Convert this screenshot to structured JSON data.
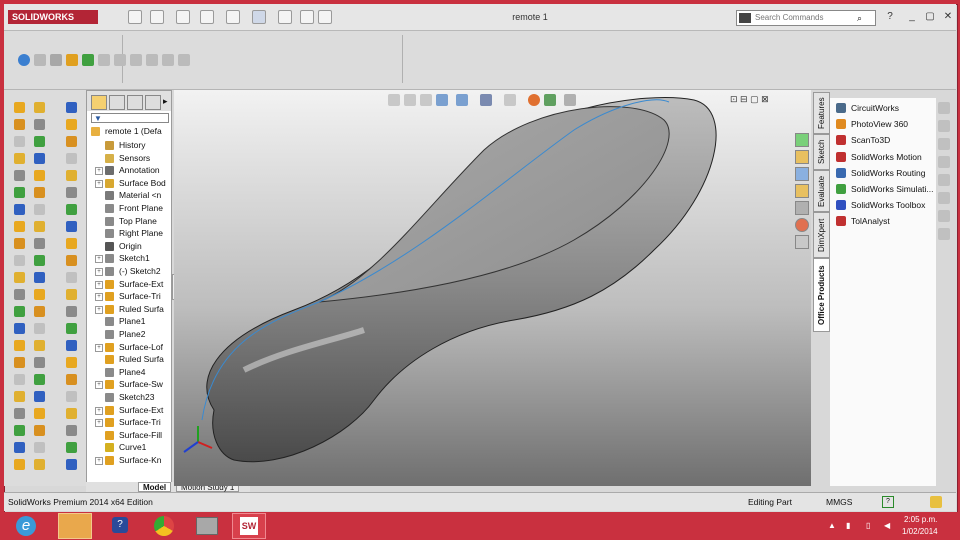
{
  "app": {
    "logo_text": "SOLIDWORKS",
    "doc_title": "remote 1"
  },
  "search": {
    "placeholder": "Search Commands"
  },
  "window_controls": {
    "help": "?",
    "minimize": "_",
    "restore": "▢",
    "close": "✕"
  },
  "feature_tree": {
    "root": "remote 1  (Defa",
    "items": [
      {
        "label": "History",
        "icon": "history-icon",
        "color": "#c89a3a",
        "expandable": false
      },
      {
        "label": "Sensors",
        "icon": "sensors-icon",
        "color": "#d6b048",
        "expandable": false
      },
      {
        "label": "Annotation",
        "icon": "annotations-icon",
        "color": "#6d6d6d",
        "expandable": true
      },
      {
        "label": "Surface Bod",
        "icon": "surface-bodies-icon",
        "color": "#d8a830",
        "expandable": true
      },
      {
        "label": "Material <n",
        "icon": "material-icon",
        "color": "#7a7a7a",
        "expandable": false
      },
      {
        "label": "Front Plane",
        "icon": "plane-icon",
        "color": "#8a8a8a",
        "expandable": false
      },
      {
        "label": "Top Plane",
        "icon": "plane-icon",
        "color": "#8a8a8a",
        "expandable": false
      },
      {
        "label": "Right Plane",
        "icon": "plane-icon",
        "color": "#8a8a8a",
        "expandable": false
      },
      {
        "label": "Origin",
        "icon": "origin-icon",
        "color": "#555555",
        "expandable": false
      },
      {
        "label": "Sketch1",
        "icon": "sketch-icon",
        "color": "#8a8a8a",
        "expandable": true
      },
      {
        "label": "(-) Sketch2",
        "icon": "sketch-icon",
        "color": "#8a8a8a",
        "expandable": true
      },
      {
        "label": "Surface-Ext",
        "icon": "surface-extrude-icon",
        "color": "#e0a020",
        "expandable": true
      },
      {
        "label": "Surface-Tri",
        "icon": "surface-trim-icon",
        "color": "#e0a020",
        "expandable": true
      },
      {
        "label": "Ruled Surfa",
        "icon": "ruled-surface-icon",
        "color": "#e0a020",
        "expandable": true
      },
      {
        "label": "Plane1",
        "icon": "plane-icon",
        "color": "#8a8a8a",
        "expandable": false
      },
      {
        "label": "Plane2",
        "icon": "plane-icon",
        "color": "#8a8a8a",
        "expandable": false
      },
      {
        "label": "Surface-Lof",
        "icon": "surface-loft-icon",
        "color": "#e0a020",
        "expandable": true
      },
      {
        "label": "Ruled Surfa",
        "icon": "ruled-surface-icon",
        "color": "#e0a020",
        "expandable": false
      },
      {
        "label": "Plane4",
        "icon": "plane-icon",
        "color": "#8a8a8a",
        "expandable": false
      },
      {
        "label": "Surface-Sw",
        "icon": "surface-sweep-icon",
        "color": "#e0a020",
        "expandable": true
      },
      {
        "label": "Sketch23",
        "icon": "sketch-icon",
        "color": "#8a8a8a",
        "expandable": false
      },
      {
        "label": "Surface-Ext",
        "icon": "surface-extrude-icon",
        "color": "#e0a020",
        "expandable": true
      },
      {
        "label": "Surface-Tri",
        "icon": "surface-trim-icon",
        "color": "#e0a020",
        "expandable": true
      },
      {
        "label": "Surface-Fill",
        "icon": "surface-fill-icon",
        "color": "#e0a020",
        "expandable": false
      },
      {
        "label": "Curve1",
        "icon": "curve-icon",
        "color": "#d4b020",
        "expandable": false
      },
      {
        "label": "Surface-Kn",
        "icon": "surface-knit-icon",
        "color": "#e0a020",
        "expandable": true
      }
    ]
  },
  "bottom_tabs": [
    "Model",
    "Motion Study 1"
  ],
  "right_tabs": [
    "Features",
    "Sketch",
    "Evaluate",
    "DimXpert",
    "Office Products"
  ],
  "addins": [
    {
      "label": "CircuitWorks",
      "icon": "circuitworks-icon",
      "color": "#4a6a8a"
    },
    {
      "label": "PhotoView 360",
      "icon": "photoview-icon",
      "color": "#e08a20"
    },
    {
      "label": "ScanTo3D",
      "icon": "scanto3d-icon",
      "color": "#c03030"
    },
    {
      "label": "SolidWorks Motion",
      "icon": "motion-icon",
      "color": "#c03030"
    },
    {
      "label": "SolidWorks Routing",
      "icon": "routing-icon",
      "color": "#3a6ab0"
    },
    {
      "label": "SolidWorks Simulati...",
      "icon": "simulation-icon",
      "color": "#40a040"
    },
    {
      "label": "SolidWorks Toolbox",
      "icon": "toolbox-icon",
      "color": "#3050c0"
    },
    {
      "label": "TolAnalyst",
      "icon": "tolanalyst-icon",
      "color": "#c03030"
    }
  ],
  "status": {
    "edition": "SolidWorks Premium 2014 x64 Edition",
    "mode": "Editing Part",
    "units": "MMGS",
    "help": "?"
  },
  "tray": {
    "time": "2:05 p.m.",
    "date": "1/02/2014"
  },
  "colors": {
    "accent": "#b32536",
    "taskbar": "#c9303f",
    "curve": "#3a8ad0"
  }
}
